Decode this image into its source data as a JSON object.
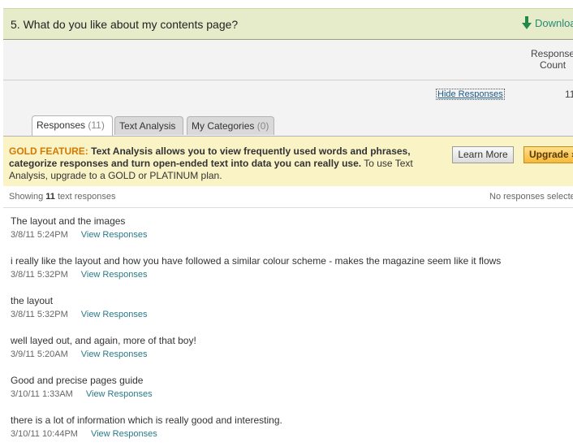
{
  "question": {
    "title": "5. What do you like about my contents page?",
    "download_label": "Downloa"
  },
  "response_count": {
    "header_line1": "Response",
    "header_line2": "Count",
    "value": "11",
    "hide_label": "Hide Responses"
  },
  "tabs": [
    {
      "label": "Responses",
      "count": "(11)",
      "active": true
    },
    {
      "label": "Text Analysis",
      "count": "",
      "active": false
    },
    {
      "label": "My Categories",
      "count": "(0)",
      "active": false
    }
  ],
  "gold": {
    "prefix": "GOLD FEATURE:",
    "bold_text": "Text Analysis allows you to view frequently used words and phrases, categorize responses and turn open-ended text into data you can really use.",
    "normal_text": "To use Text Analysis, upgrade to a GOLD or PLATINUM plan.",
    "learn_more": "Learn More",
    "upgrade": "Upgrade »"
  },
  "showing": {
    "prefix": "Showing",
    "count": "11",
    "suffix": "text responses",
    "no_selected": "No responses selecte"
  },
  "view_label": "View Responses",
  "responses": [
    {
      "text": "The layout and the images",
      "date": "3/8/11 5:24PM"
    },
    {
      "text": "i really like the layout and how you have followed a similar colour scheme - makes the magazine seem like it flows",
      "date": "3/8/11 5:32PM"
    },
    {
      "text": "the layout",
      "date": "3/8/11 5:32PM"
    },
    {
      "text": "well layed out, and again, more of that boy!",
      "date": "3/9/11 5:20AM"
    },
    {
      "text": "Good and precise pages guide",
      "date": "3/10/11 1:33AM"
    },
    {
      "text": "there is a lot of information which is really good and interesting.",
      "date": "3/10/11 10:44PM"
    }
  ]
}
